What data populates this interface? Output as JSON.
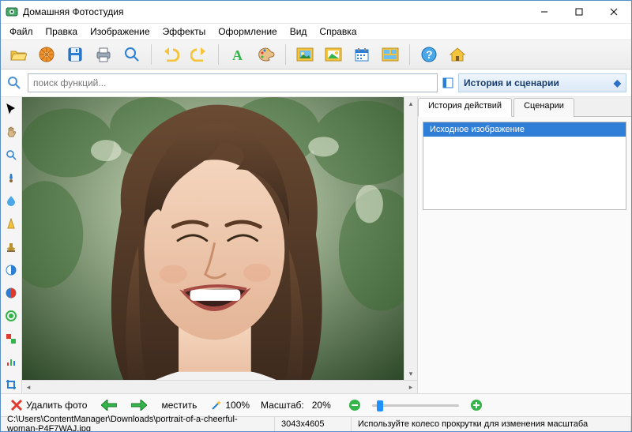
{
  "window": {
    "title": "Домашняя Фотостудия"
  },
  "menu": {
    "file": "Файл",
    "edit": "Правка",
    "image": "Изображение",
    "effects": "Эффекты",
    "decoration": "Оформление",
    "view": "Вид",
    "help": "Справка"
  },
  "search": {
    "placeholder": "поиск функций..."
  },
  "panel": {
    "title": "История и сценарии",
    "tabs": {
      "history": "История действий",
      "scenarios": "Сценарии"
    }
  },
  "history": {
    "items": [
      "Исходное изображение"
    ]
  },
  "bottom": {
    "delete": "Удалить фото",
    "fit": "местить",
    "hundred": "100%",
    "scale_label": "Масштаб:",
    "scale_value": "20%"
  },
  "status": {
    "path": "C:\\Users\\ContentManager\\Downloads\\portrait-of-a-cheerful-woman-P4F7WAJ.jpg",
    "dimensions": "3043x4605",
    "hint": "Используйте колесо прокрутки для изменения масштаба"
  },
  "colors": {
    "accent": "#2f7fd9",
    "yellow": "#f5c43d",
    "green": "#34b44a",
    "blue": "#2a7fd4",
    "red": "#e03a2f",
    "orange": "#f0932b"
  }
}
